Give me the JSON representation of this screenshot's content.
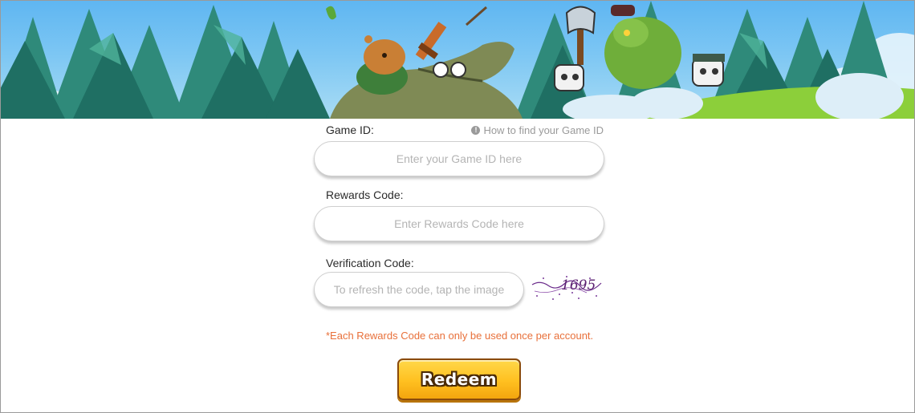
{
  "colors": {
    "notice": "#e8703a",
    "button": "#ffc020",
    "label": "#2b2b2b",
    "placeholder": "#b4b4b4"
  },
  "banner": {
    "scene": "cartoon forest battle artwork with capybara hero, crocodile, orc and skeleton warriors"
  },
  "form": {
    "game_id": {
      "label": "Game ID:",
      "placeholder": "Enter your Game ID here",
      "value": ""
    },
    "help": {
      "icon": "info-icon",
      "text": "How to find your Game ID"
    },
    "rewards_code": {
      "label": "Rewards Code:",
      "placeholder": "Enter Rewards Code here",
      "value": ""
    },
    "verification_code": {
      "label": "Verification Code:",
      "placeholder": "To refresh the code, tap the image",
      "value": "",
      "captcha_text": "1695"
    },
    "notice": "*Each Rewards Code can only be used once per account.",
    "redeem_label": "Redeem"
  }
}
